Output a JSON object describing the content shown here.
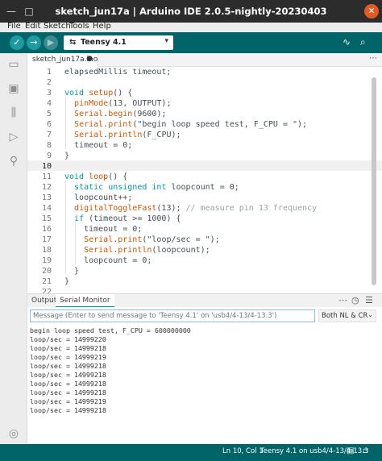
{
  "window": {
    "title": "sketch_jun17a | Arduino IDE 2.0.5-nightly-20230403",
    "minimize_glyph": "—",
    "maximize_glyph": "□",
    "close_glyph": "✕"
  },
  "menu": [
    "File",
    "Edit",
    "Sketch",
    "Tools",
    "Help"
  ],
  "toolbar": {
    "verify_glyph": "✓",
    "upload_glyph": "→",
    "debug_glyph": "▶",
    "board_icon": "usb-icon",
    "board_glyph": "⇆",
    "board_name": "Teensy 4.1",
    "dropdown_glyph": "▾",
    "plotter_glyph": "∿",
    "monitor_glyph": "⌕"
  },
  "sidebar": {
    "icons": [
      {
        "name": "folder-icon",
        "glyph": "▭"
      },
      {
        "name": "boards-manager-icon",
        "glyph": "▣"
      },
      {
        "name": "library-manager-icon",
        "glyph": "⫼"
      },
      {
        "name": "debug-icon",
        "glyph": "▷"
      },
      {
        "name": "search-icon",
        "glyph": "⚲"
      }
    ],
    "account_glyph": "◎"
  },
  "editor_tabs": {
    "active": "sketch_jun17a.ino",
    "modified_glyph": "●",
    "more_glyph": "⋯"
  },
  "editor": {
    "current_line": 10,
    "lines": [
      {
        "n": "1",
        "code": "elapsedMillis timeout;"
      },
      {
        "n": "2",
        "code": ""
      },
      {
        "n": "3",
        "code": "void setup() {"
      },
      {
        "n": "4",
        "code": "  pinMode(13, OUTPUT);"
      },
      {
        "n": "5",
        "code": "  Serial.begin(9600);"
      },
      {
        "n": "6",
        "code": "  Serial.print(\"begin loop speed test, F_CPU = \");"
      },
      {
        "n": "7",
        "code": "  Serial.println(F_CPU);"
      },
      {
        "n": "8",
        "code": "  timeout = 0;"
      },
      {
        "n": "9",
        "code": "}"
      },
      {
        "n": "10",
        "code": ""
      },
      {
        "n": "11",
        "code": "void loop() {"
      },
      {
        "n": "12",
        "code": "  static unsigned int loopcount = 0;"
      },
      {
        "n": "13",
        "code": "  loopcount++;"
      },
      {
        "n": "14",
        "code": "  digitalToggleFast(13); // measure pin 13 frequency"
      },
      {
        "n": "15",
        "code": "  if (timeout >= 1000) {"
      },
      {
        "n": "16",
        "code": "    timeout = 0;"
      },
      {
        "n": "17",
        "code": "    Serial.print(\"loop/sec = \");"
      },
      {
        "n": "18",
        "code": "    Serial.println(loopcount);"
      },
      {
        "n": "19",
        "code": "    loopcount = 0;"
      },
      {
        "n": "20",
        "code": "  }"
      },
      {
        "n": "21",
        "code": "}"
      },
      {
        "n": "22",
        "code": ""
      }
    ]
  },
  "output_panel": {
    "tab_output": "Output",
    "tab_serial_monitor": "Serial Monitor",
    "more_glyph": "⋯",
    "timestamp_glyph": "◷",
    "clear_glyph": "☰",
    "message_placeholder": "Message (Enter to send message to 'Teensy 4.1' on 'usb4/4-13/4-13.3')",
    "line_ending": "Both NL & CR",
    "line_ending_caret": "⌄",
    "lines": [
      "begin loop speed test, F_CPU = 600000000",
      "loop/sec = 14999220",
      "loop/sec = 14999218",
      "loop/sec = 14999219",
      "loop/sec = 14999218",
      "loop/sec = 14999218",
      "loop/sec = 14999218",
      "loop/sec = 14999218",
      "loop/sec = 14999219",
      "loop/sec = 14999218"
    ]
  },
  "statusbar": {
    "position": "Ln 10, Col 1",
    "board": "Teensy 4.1 on usb4/4-13/4-13.3",
    "notification_glyph": "▤",
    "close_glyph": "▫"
  },
  "colors": {
    "toolbar": "#006468",
    "accent": "#00979c",
    "keyword": "#00979c",
    "function": "#d35400",
    "comment": "#95a5a6"
  }
}
